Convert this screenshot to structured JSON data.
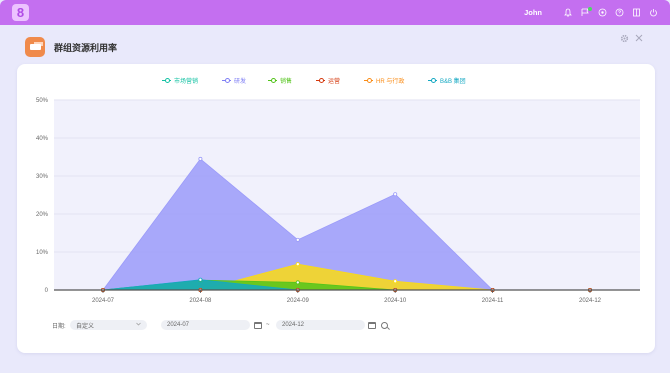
{
  "topbar": {
    "app_logo": "8",
    "username": "John",
    "icons": [
      "bell-icon",
      "flag-icon",
      "settings-icon",
      "help-icon",
      "split-view-icon",
      "power-icon"
    ]
  },
  "window": {
    "title": "群组资源利用率",
    "controls": [
      "gear-icon",
      "close-icon"
    ]
  },
  "chart_data": {
    "type": "area",
    "categories": [
      "2024-07",
      "2024-08",
      "2024-09",
      "2024-10",
      "2024-11",
      "2024-12"
    ],
    "y_ticks": [
      "0",
      "10%",
      "20%",
      "30%",
      "40%",
      "50%"
    ],
    "ylim": [
      0,
      50
    ],
    "legend_position": "top-center",
    "series": [
      {
        "name": "市场营销",
        "color": "#13c2a3",
        "values": [
          0,
          0,
          0,
          0,
          0,
          0
        ]
      },
      {
        "name": "研发",
        "color": "#9b9bf9",
        "values": [
          0,
          34.5,
          13.2,
          25.2,
          0,
          0
        ]
      },
      {
        "name": "销售",
        "color": "#52c41a",
        "values": [
          0,
          2.6,
          2.0,
          0,
          0,
          0
        ]
      },
      {
        "name": "运营",
        "color": "#d4380d",
        "values": [
          0,
          0,
          0,
          0,
          0,
          0
        ]
      },
      {
        "name": "HR 与行政",
        "color": "#fadb14",
        "values": [
          0,
          0,
          6.8,
          2.3,
          0,
          0
        ]
      },
      {
        "name": "B&B 集团",
        "color": "#13a8c2",
        "values": [
          0,
          2.7,
          0,
          0,
          0,
          0
        ]
      }
    ]
  },
  "controls": {
    "date_label": "日期:",
    "range_type": "自定义",
    "start_date": "2024-07",
    "separator": "~",
    "end_date": "2024-12"
  }
}
